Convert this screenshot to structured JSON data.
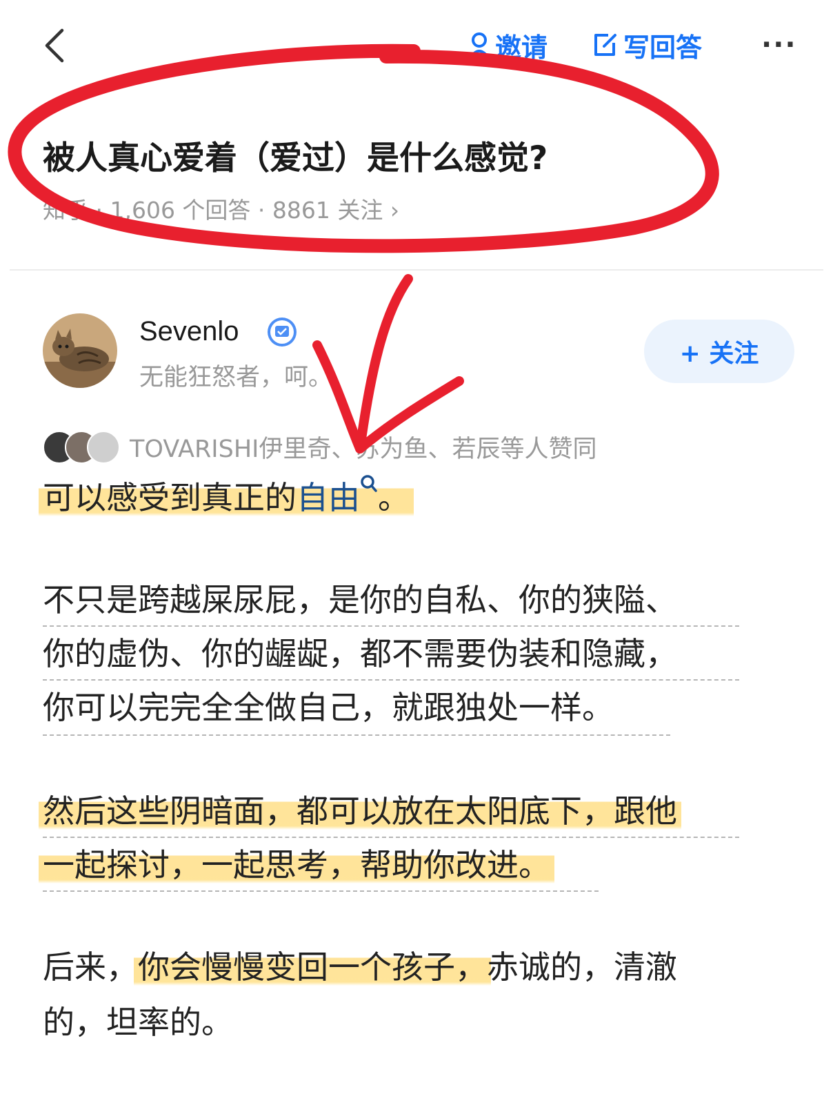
{
  "topbar": {
    "invite_label": "邀请",
    "write_answer_label": "写回答",
    "more_label": "···"
  },
  "question": {
    "title": "被人真心爱着（爱过）是什么感觉?",
    "meta": "知乎 · 1,606 个回答 · 8861 关注 ›"
  },
  "author": {
    "name": "Sevenlo",
    "bio": "无能狂怒者，呵。",
    "follow_label": "+ 关注"
  },
  "voters": {
    "text": "TOVARISHI伊里奇、苏为鱼、若辰等人赞同"
  },
  "answer": {
    "p1_before": "可以感受到真正的",
    "p1_link": "自由",
    "p1_after": "。",
    "p2_line1": "不只是跨越屎尿屁，是你的自私、你的狭隘、",
    "p2_line2": "你的虚伪、你的龌龊，都不需要伪装和隐藏，",
    "p2_line3": "你可以完完全全做自己，就跟独处一样。",
    "p3_line1": "然后这些阴暗面，都可以放在太阳底下，跟他",
    "p3_line2": "一起探讨，一起思考，帮助你改进。",
    "p4_before": "后来，",
    "p4_highlight": "你会慢慢变回一个孩子，",
    "p4_after": "赤诚的，清澈",
    "p4_line2": "的，坦率的。"
  },
  "colors": {
    "accent": "#1772f6",
    "highlight": "#ffd978",
    "annotation": "#e8202e"
  }
}
